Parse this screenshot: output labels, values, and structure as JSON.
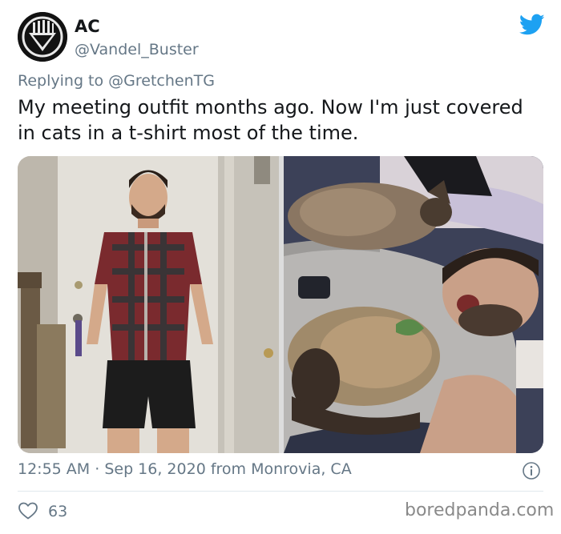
{
  "author": {
    "display_name": "AC",
    "handle": "@Vandel_Buster"
  },
  "reply": {
    "prefix": "Replying to",
    "target": "@GretchenTG"
  },
  "tweet": {
    "text": "My meeting outfit months ago. Now I'm just covered in cats in a t-shirt most of the time."
  },
  "meta": {
    "time": "12:55 AM",
    "separator": "·",
    "date": "Sep 16, 2020",
    "location": "from Monrovia, CA"
  },
  "engagement": {
    "likes": "63"
  },
  "watermark": "boredpanda.com",
  "colors": {
    "twitter_blue": "#1da1f2",
    "secondary_text": "#657786",
    "primary_text": "#14171a"
  },
  "icons": [
    "avatar-logo",
    "twitter-bird-icon",
    "info-icon",
    "heart-icon"
  ]
}
